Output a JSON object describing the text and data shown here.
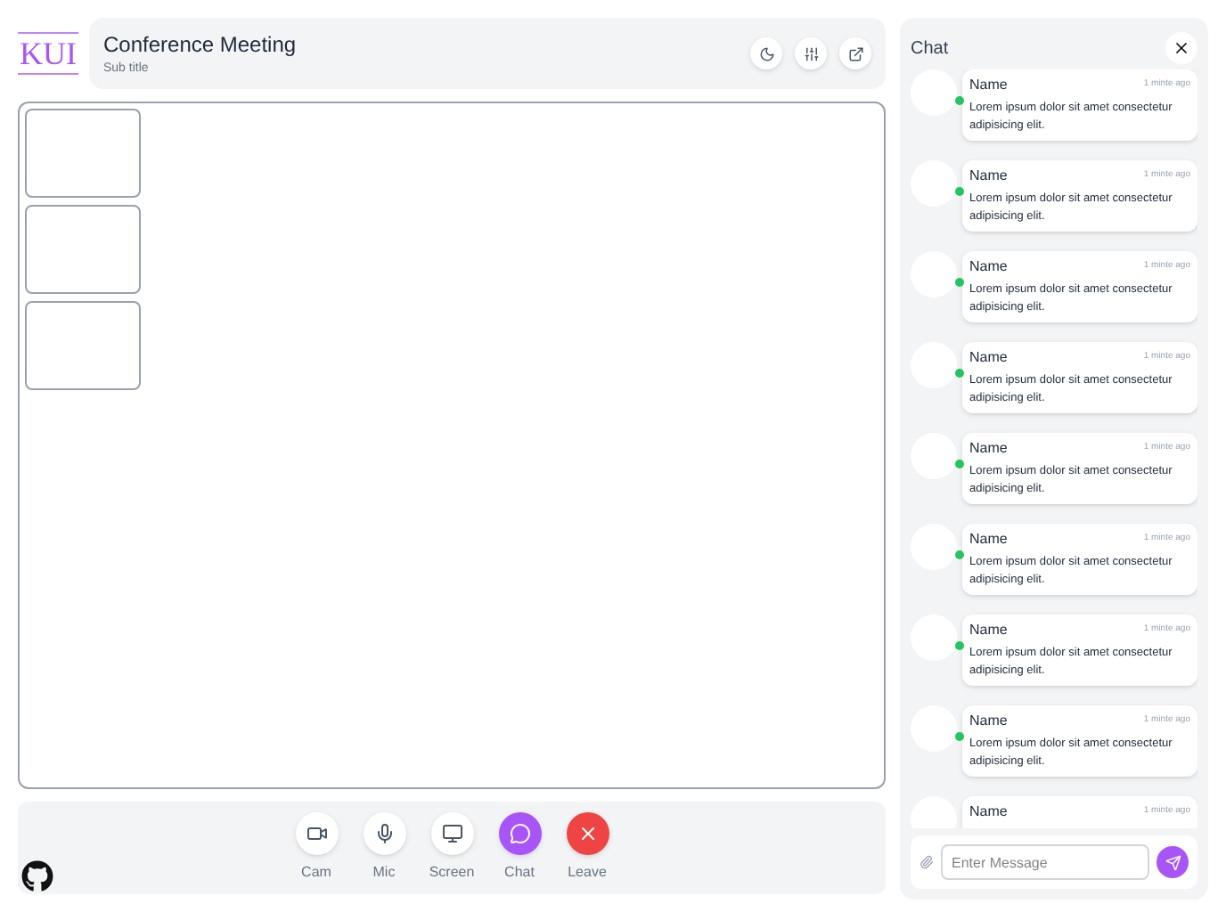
{
  "logo": "KUI",
  "header": {
    "title": "Conference Meeting",
    "subtitle": "Sub title"
  },
  "thumbnails": [
    {
      "kind": "tile"
    },
    {
      "kind": "tile"
    },
    {
      "kind": "tile"
    }
  ],
  "controls": [
    {
      "kind": "cam",
      "label": "Cam",
      "selected": false
    },
    {
      "kind": "mic",
      "label": "Mic",
      "selected": false
    },
    {
      "kind": "screen",
      "label": "Screen",
      "selected": false
    },
    {
      "kind": "chat",
      "label": "Chat",
      "selected": true
    },
    {
      "kind": "leave",
      "label": "Leave",
      "selected": false
    }
  ],
  "chat": {
    "title": "Chat",
    "placeholder": "Enter Message",
    "messages": [
      {
        "name": "Name",
        "time": "1 minte ago",
        "text": "Lorem ipsum dolor sit amet consectetur adipisicing elit.",
        "online": true
      },
      {
        "name": "Name",
        "time": "1 minte ago",
        "text": "Lorem ipsum dolor sit amet consectetur adipisicing elit.",
        "online": true
      },
      {
        "name": "Name",
        "time": "1 minte ago",
        "text": "Lorem ipsum dolor sit amet consectetur adipisicing elit.",
        "online": true
      },
      {
        "name": "Name",
        "time": "1 minte ago",
        "text": "Lorem ipsum dolor sit amet consectetur adipisicing elit.",
        "online": true
      },
      {
        "name": "Name",
        "time": "1 minte ago",
        "text": "Lorem ipsum dolor sit amet consectetur adipisicing elit.",
        "online": true
      },
      {
        "name": "Name",
        "time": "1 minte ago",
        "text": "Lorem ipsum dolor sit amet consectetur adipisicing elit.",
        "online": true
      },
      {
        "name": "Name",
        "time": "1 minte ago",
        "text": "Lorem ipsum dolor sit amet consectetur adipisicing elit.",
        "online": true
      },
      {
        "name": "Name",
        "time": "1 minte ago",
        "text": "Lorem ipsum dolor sit amet consectetur adipisicing elit.",
        "online": true
      },
      {
        "name": "Name",
        "time": "1 minte ago",
        "online": false
      }
    ]
  }
}
